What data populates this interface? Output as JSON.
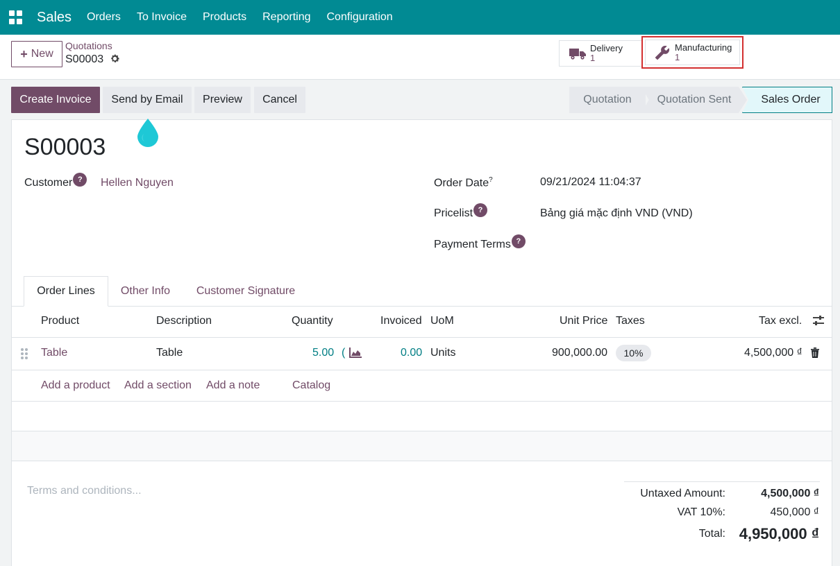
{
  "nav": {
    "brand": "Sales",
    "items": [
      "Orders",
      "To Invoice",
      "Products",
      "Reporting",
      "Configuration"
    ]
  },
  "control": {
    "new_label": "New",
    "breadcrumb": "Quotations",
    "record": "S00003",
    "smart_buttons": [
      {
        "label": "Delivery",
        "count": "1"
      },
      {
        "label": "Manufacturing",
        "count": "1"
      }
    ]
  },
  "actions": {
    "create_invoice": "Create Invoice",
    "send_email": "Send by Email",
    "preview": "Preview",
    "cancel": "Cancel"
  },
  "statusbar": [
    "Quotation",
    "Quotation Sent",
    "Sales Order"
  ],
  "form": {
    "title": "S00003",
    "customer_label": "Customer",
    "customer": "Hellen Nguyen",
    "order_date_label": "Order Date",
    "order_date": "09/21/2024 11:04:37",
    "pricelist_label": "Pricelist",
    "pricelist": "Bảng giá mặc định VND (VND)",
    "payment_terms_label": "Payment Terms",
    "help_mark": "?"
  },
  "tabs": [
    "Order Lines",
    "Other Info",
    "Customer Signature"
  ],
  "table": {
    "headers": [
      "Product",
      "Description",
      "Quantity",
      "Invoiced",
      "UoM",
      "Unit Price",
      "Taxes",
      "Tax excl."
    ],
    "rows": [
      {
        "product": "Table",
        "description": "Table",
        "quantity": "5.00",
        "invoiced": "0.00",
        "uom": "Units",
        "unit_price": "900,000.00",
        "taxes": "10%",
        "subtotal": "4,500,000 ₫"
      }
    ],
    "add_links": [
      "Add a product",
      "Add a section",
      "Add a note",
      "Catalog"
    ]
  },
  "terms_placeholder": "Terms and conditions...",
  "totals": {
    "untaxed_label": "Untaxed Amount:",
    "untaxed": "4,500,000 ₫",
    "vat_label": "VAT 10%:",
    "vat": "450,000 ₫",
    "total_label": "Total:",
    "total": "4,950,000 ₫"
  },
  "colors": {
    "navbar": "#018a93",
    "primary": "#714b67",
    "accent": "#017e84",
    "highlight_box": "#d32f2f"
  }
}
